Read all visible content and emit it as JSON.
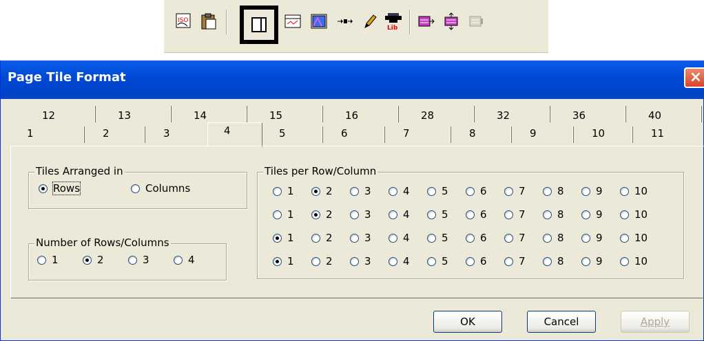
{
  "toolbar": {
    "buttons": [
      {
        "name": "iso-icon",
        "label": "ISO"
      },
      {
        "name": "clipboard-icon"
      },
      {
        "name": "page-tile-icon"
      },
      {
        "name": "chart-window-icon"
      },
      {
        "name": "trend-window-icon"
      },
      {
        "name": "arrow-flow-icon"
      },
      {
        "name": "pencil-icon"
      },
      {
        "name": "library-icon",
        "label": "Lib"
      },
      {
        "name": "signal-arrow-icon"
      },
      {
        "name": "signal-updown-icon"
      },
      {
        "name": "signal-disabled-icon"
      }
    ]
  },
  "dialog": {
    "title": "Page Tile Format",
    "close": "×"
  },
  "tabs": {
    "row1": [
      "12",
      "13",
      "14",
      "15",
      "16",
      "28",
      "32",
      "36",
      "40"
    ],
    "row2": [
      "1",
      "2",
      "3",
      "4",
      "5",
      "6",
      "7",
      "8",
      "9",
      "10",
      "11"
    ],
    "selected": "4"
  },
  "arranged": {
    "legend": "Tiles Arranged in",
    "options": [
      "Rows",
      "Columns"
    ],
    "selected": "Rows"
  },
  "numrows": {
    "legend": "Number of Rows/Columns",
    "options": [
      "1",
      "2",
      "3",
      "4"
    ],
    "selected": "2"
  },
  "tiles": {
    "legend": "Tiles per Row/Column",
    "options": [
      "1",
      "2",
      "3",
      "4",
      "5",
      "6",
      "7",
      "8",
      "9",
      "10"
    ],
    "rows_selected": [
      "2",
      "2",
      "1",
      "1"
    ]
  },
  "buttons": {
    "ok": "OK",
    "cancel": "Cancel",
    "apply": "Apply"
  }
}
